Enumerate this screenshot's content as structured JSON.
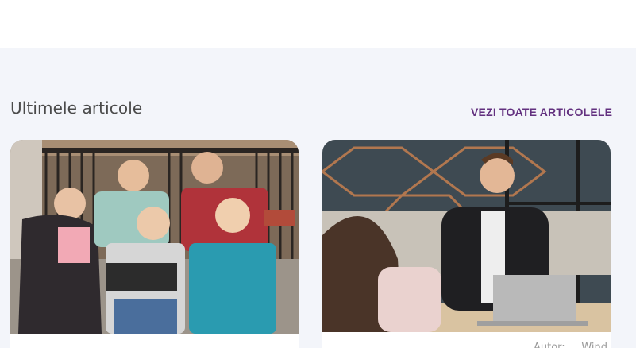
{
  "section": {
    "title": "Ultimele articole",
    "see_all_label": "VEZI TOATE ARTICOLELE",
    "accent_color": "#62307f",
    "background_color": "#f3f5fa"
  },
  "articles": [
    {
      "image": "group-of-students-photo",
      "author": ""
    },
    {
      "image": "job-interview-photo",
      "author": "Autor: ... Wind"
    }
  ]
}
